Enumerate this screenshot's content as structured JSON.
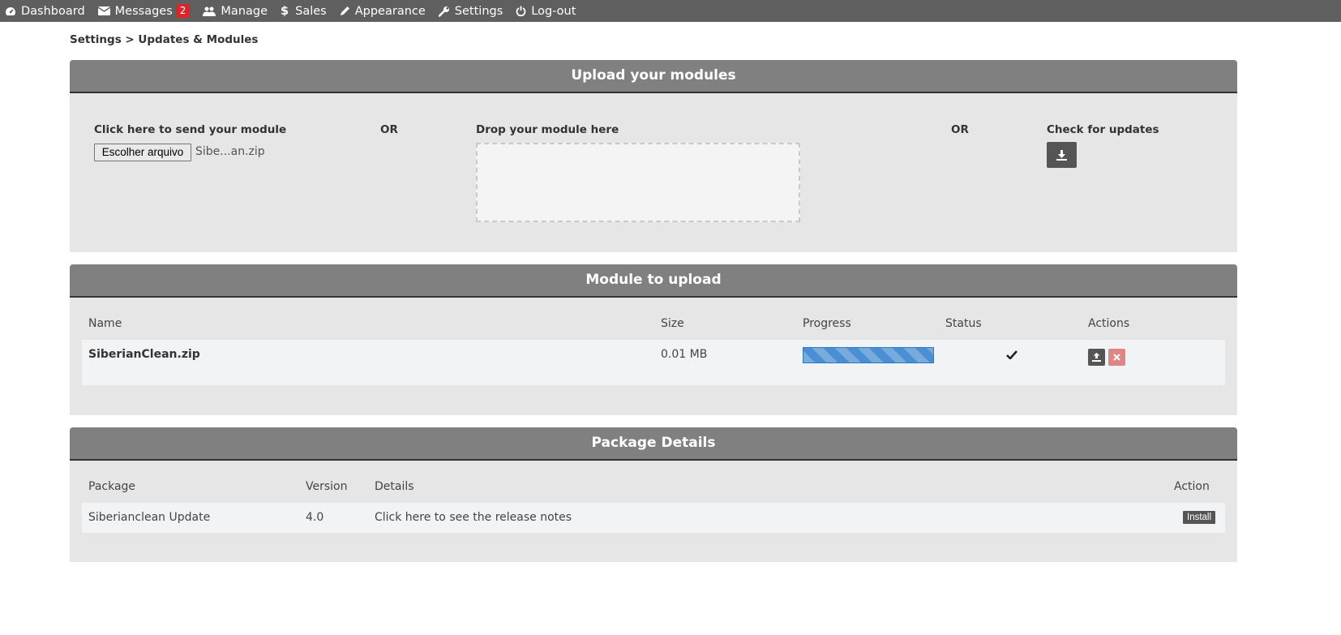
{
  "nav": {
    "items": [
      {
        "label": "Dashboard",
        "icon": "dashboard-icon"
      },
      {
        "label": "Messages",
        "icon": "envelope-icon",
        "badge": "2"
      },
      {
        "label": "Manage",
        "icon": "users-icon"
      },
      {
        "label": "Sales",
        "icon": "dollar-icon"
      },
      {
        "label": "Appearance",
        "icon": "pencil-icon"
      },
      {
        "label": "Settings",
        "icon": "wrench-icon"
      },
      {
        "label": "Log-out",
        "icon": "power-icon"
      }
    ]
  },
  "breadcrumb": "Settings > Updates & Modules",
  "upload_panel": {
    "title": "Upload your modules",
    "send_label": "Click here to send your module",
    "file_button": "Escolher arquivo",
    "file_name": "Sibe...an.zip",
    "or_1": "OR",
    "drop_label": "Drop your module here",
    "or_2": "OR",
    "check_label": "Check for updates"
  },
  "module_panel": {
    "title": "Module to upload",
    "headers": {
      "name": "Name",
      "size": "Size",
      "progress": "Progress",
      "status": "Status",
      "actions": "Actions"
    },
    "row": {
      "name": "SiberianClean.zip",
      "size": "0.01 MB",
      "progress_percent": 100,
      "status_icon": "check-icon"
    }
  },
  "package_panel": {
    "title": "Package Details",
    "headers": {
      "package": "Package",
      "version": "Version",
      "details": "Details",
      "action": "Action"
    },
    "row": {
      "package": "Siberianclean Update",
      "version": "4.0",
      "details": "Click here to see the release notes",
      "action": "Install"
    }
  },
  "colors": {
    "nav_bg": "#5f5f5f",
    "panel_header": "#808080",
    "panel_body": "#e6e6e6",
    "badge": "#d9262a",
    "progress": "#4a8fd3",
    "delete": "#e08585"
  }
}
